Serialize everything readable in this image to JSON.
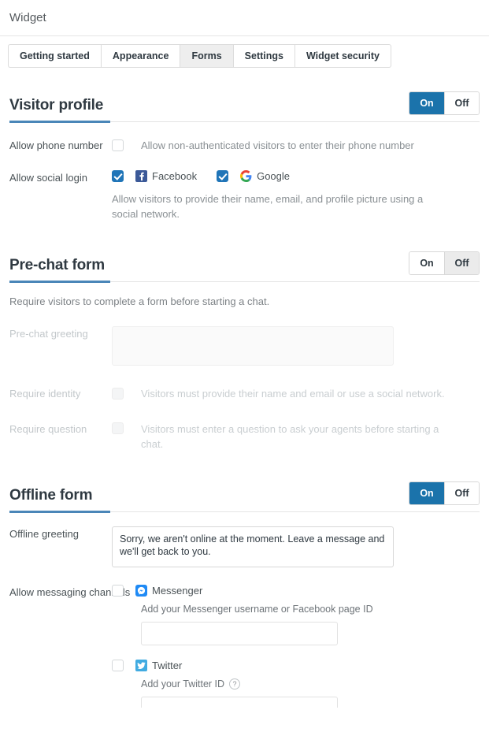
{
  "header": {
    "title": "Widget"
  },
  "tabs": [
    {
      "label": "Getting started",
      "active": false
    },
    {
      "label": "Appearance",
      "active": false
    },
    {
      "label": "Forms",
      "active": true
    },
    {
      "label": "Settings",
      "active": false
    },
    {
      "label": "Widget security",
      "active": false
    }
  ],
  "toggle_labels": {
    "on": "On",
    "off": "Off"
  },
  "colors": {
    "accent_blue": "#1b73ab",
    "heading_underline": "#4a86b8",
    "checkbox_checked": "#2075b8",
    "facebook": "#3b5998",
    "messenger": "#1f8af5",
    "twitter": "#41abe1"
  },
  "visitor_profile": {
    "title": "Visitor profile",
    "state": "On",
    "phone": {
      "label": "Allow phone number",
      "checked": false,
      "description": "Allow non-authenticated visitors to enter their phone number"
    },
    "social": {
      "label": "Allow social login",
      "options": [
        {
          "name": "Facebook",
          "icon": "facebook-icon",
          "checked": true
        },
        {
          "name": "Google",
          "icon": "google-icon",
          "checked": true
        }
      ],
      "description": "Allow visitors to provide their name, email, and profile picture using a social network."
    }
  },
  "prechat_form": {
    "title": "Pre-chat form",
    "state": "Off",
    "description": "Require visitors to complete a form before starting a chat.",
    "greeting": {
      "label": "Pre-chat greeting",
      "value": "",
      "disabled": true
    },
    "require_identity": {
      "label": "Require identity",
      "checked": false,
      "disabled": true,
      "description": "Visitors must provide their name and email or use a social network."
    },
    "require_question": {
      "label": "Require question",
      "checked": false,
      "disabled": true,
      "description": "Visitors must enter a question to ask your agents before starting a chat."
    }
  },
  "offline_form": {
    "title": "Offline form",
    "state": "On",
    "greeting": {
      "label": "Offline greeting",
      "value": "Sorry, we aren't online at the moment. Leave a message and we'll get back to you."
    },
    "messaging": {
      "label": "Allow messaging channels",
      "channels": [
        {
          "name": "Messenger",
          "icon": "messenger-icon",
          "checked": false,
          "note": "Add your Messenger username or Facebook page ID",
          "input_value": ""
        },
        {
          "name": "Twitter",
          "icon": "twitter-icon",
          "checked": false,
          "note": "Add your Twitter ID",
          "has_help": true,
          "help_glyph": "?",
          "input_value": ""
        }
      ]
    }
  }
}
